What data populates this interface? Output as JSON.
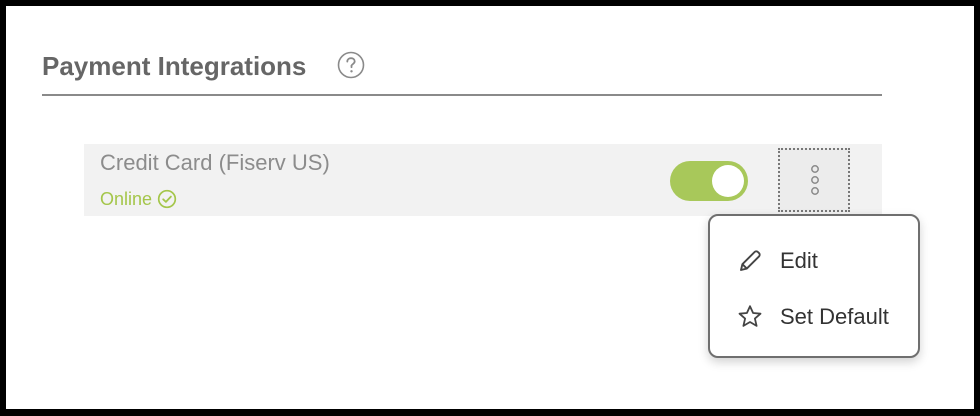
{
  "section": {
    "title": "Payment Integrations",
    "help_icon": "question-circle-icon"
  },
  "integration": {
    "name": "Credit Card (Fiserv US)",
    "status": "Online",
    "status_icon": "check-circle-icon",
    "status_color": "#a4c64a",
    "enabled": true,
    "toggle_color": "#a8c85a",
    "more_icon": "vertical-ellipsis-icon"
  },
  "menu": {
    "items": [
      {
        "label": "Edit",
        "icon": "pencil-icon"
      },
      {
        "label": "Set Default",
        "icon": "star-icon"
      }
    ]
  }
}
